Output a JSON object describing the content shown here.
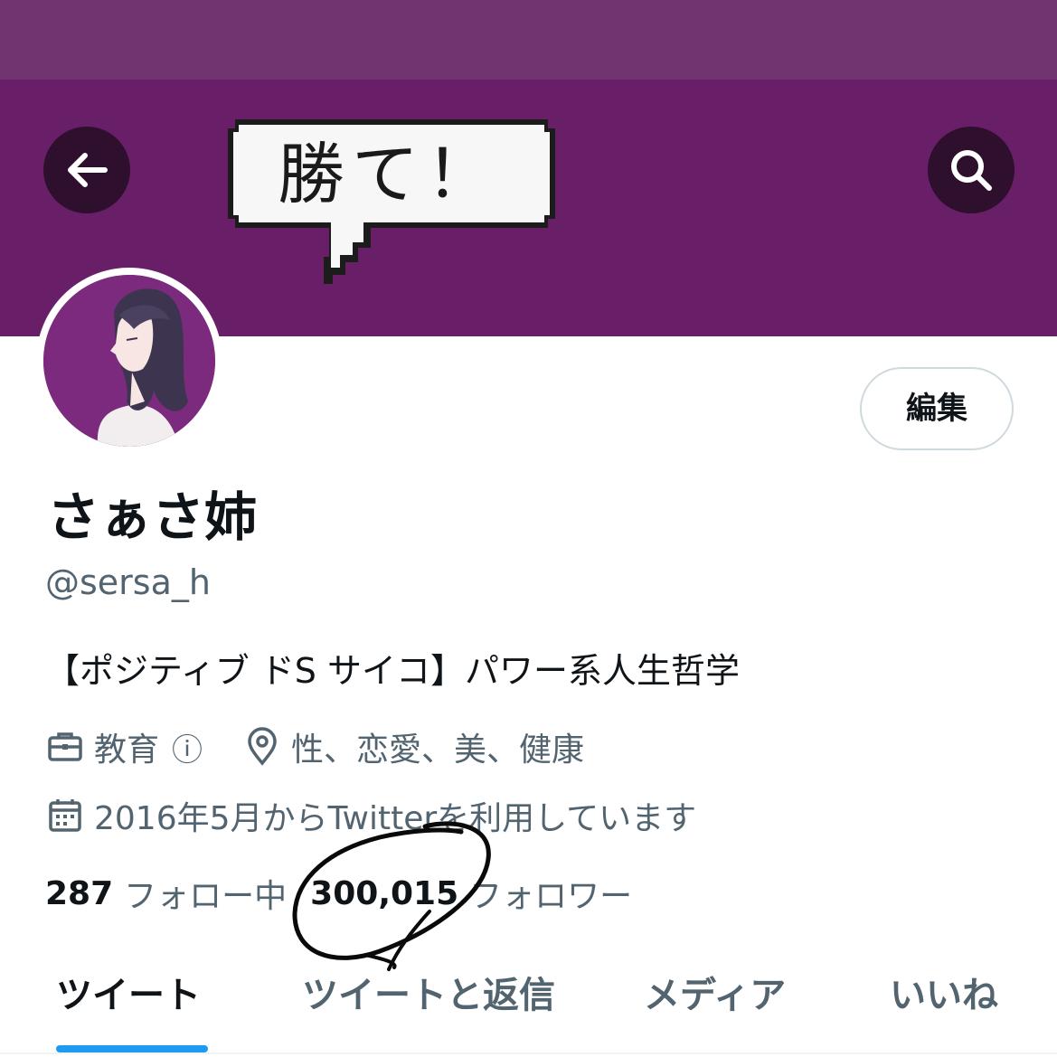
{
  "banner": {
    "speech_text": "勝て！",
    "background_color": "#681f68"
  },
  "nav": {
    "back_icon": "arrow-left-icon",
    "search_icon": "search-icon"
  },
  "profile": {
    "edit_label": "編集",
    "display_name": "さぁさ姉",
    "handle": "@sersa_h",
    "bio": "【ポジティブ ドS サイコ】パワー系人生哲学",
    "category": "教育",
    "category_info_icon": "ⓘ",
    "location": "性、恋愛、美、健康",
    "joined": "2016年5月からTwitterを利用しています"
  },
  "stats": {
    "following_count": "287",
    "following_label": "フォロー中",
    "followers_count": "300,015",
    "followers_label": "フォロワー"
  },
  "tabs": [
    {
      "label": "ツイート",
      "active": true
    },
    {
      "label": "ツイートと返信",
      "active": false
    },
    {
      "label": "メディア",
      "active": false
    },
    {
      "label": "いいね",
      "active": false
    }
  ],
  "colors": {
    "accent": "#1d9bf0",
    "secondary_text": "#536471"
  }
}
